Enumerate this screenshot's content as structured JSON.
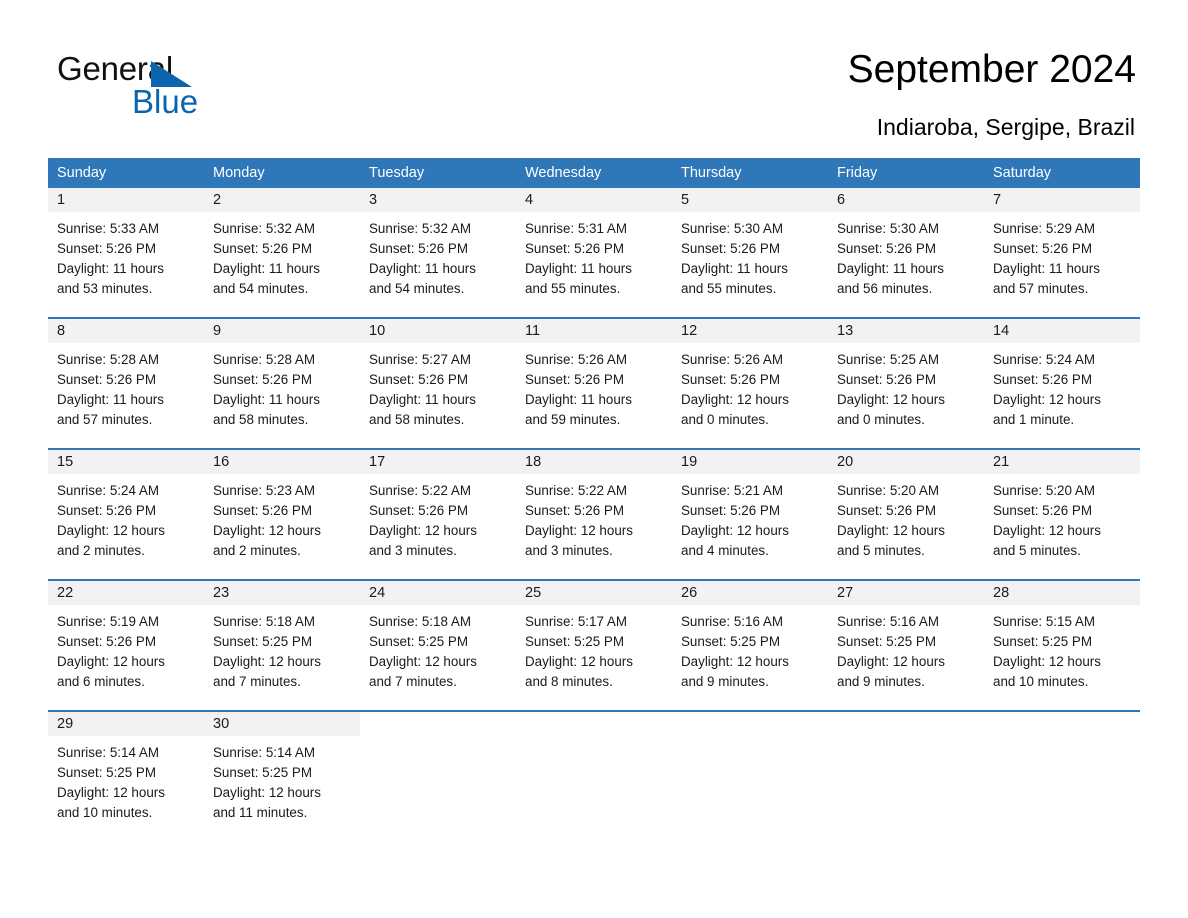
{
  "logo": {
    "word1": "General",
    "word2": "Blue",
    "triangle_color": "#0d66ad",
    "text_color": "#111111"
  },
  "header": {
    "title": "September 2024",
    "subtitle": "Indiaroba, Sergipe, Brazil"
  },
  "theme": {
    "header_bg": "#2e77b8",
    "header_text": "#ffffff",
    "daynum_bg": "#f2f2f2",
    "cell_bg": "#ffffff",
    "row_divider": "#2e77b8",
    "body_text": "#1a1a1a"
  },
  "weekdays": [
    "Sunday",
    "Monday",
    "Tuesday",
    "Wednesday",
    "Thursday",
    "Friday",
    "Saturday"
  ],
  "labels": {
    "sunrise_prefix": "Sunrise:",
    "sunset_prefix": "Sunset:",
    "daylight_prefix": "Daylight:"
  },
  "weeks": [
    {
      "days": [
        {
          "num": "1",
          "sunrise": "Sunrise: 5:33 AM",
          "sunset": "Sunset: 5:26 PM",
          "daylight1": "Daylight: 11 hours",
          "daylight2": "and 53 minutes."
        },
        {
          "num": "2",
          "sunrise": "Sunrise: 5:32 AM",
          "sunset": "Sunset: 5:26 PM",
          "daylight1": "Daylight: 11 hours",
          "daylight2": "and 54 minutes."
        },
        {
          "num": "3",
          "sunrise": "Sunrise: 5:32 AM",
          "sunset": "Sunset: 5:26 PM",
          "daylight1": "Daylight: 11 hours",
          "daylight2": "and 54 minutes."
        },
        {
          "num": "4",
          "sunrise": "Sunrise: 5:31 AM",
          "sunset": "Sunset: 5:26 PM",
          "daylight1": "Daylight: 11 hours",
          "daylight2": "and 55 minutes."
        },
        {
          "num": "5",
          "sunrise": "Sunrise: 5:30 AM",
          "sunset": "Sunset: 5:26 PM",
          "daylight1": "Daylight: 11 hours",
          "daylight2": "and 55 minutes."
        },
        {
          "num": "6",
          "sunrise": "Sunrise: 5:30 AM",
          "sunset": "Sunset: 5:26 PM",
          "daylight1": "Daylight: 11 hours",
          "daylight2": "and 56 minutes."
        },
        {
          "num": "7",
          "sunrise": "Sunrise: 5:29 AM",
          "sunset": "Sunset: 5:26 PM",
          "daylight1": "Daylight: 11 hours",
          "daylight2": "and 57 minutes."
        }
      ]
    },
    {
      "days": [
        {
          "num": "8",
          "sunrise": "Sunrise: 5:28 AM",
          "sunset": "Sunset: 5:26 PM",
          "daylight1": "Daylight: 11 hours",
          "daylight2": "and 57 minutes."
        },
        {
          "num": "9",
          "sunrise": "Sunrise: 5:28 AM",
          "sunset": "Sunset: 5:26 PM",
          "daylight1": "Daylight: 11 hours",
          "daylight2": "and 58 minutes."
        },
        {
          "num": "10",
          "sunrise": "Sunrise: 5:27 AM",
          "sunset": "Sunset: 5:26 PM",
          "daylight1": "Daylight: 11 hours",
          "daylight2": "and 58 minutes."
        },
        {
          "num": "11",
          "sunrise": "Sunrise: 5:26 AM",
          "sunset": "Sunset: 5:26 PM",
          "daylight1": "Daylight: 11 hours",
          "daylight2": "and 59 minutes."
        },
        {
          "num": "12",
          "sunrise": "Sunrise: 5:26 AM",
          "sunset": "Sunset: 5:26 PM",
          "daylight1": "Daylight: 12 hours",
          "daylight2": "and 0 minutes."
        },
        {
          "num": "13",
          "sunrise": "Sunrise: 5:25 AM",
          "sunset": "Sunset: 5:26 PM",
          "daylight1": "Daylight: 12 hours",
          "daylight2": "and 0 minutes."
        },
        {
          "num": "14",
          "sunrise": "Sunrise: 5:24 AM",
          "sunset": "Sunset: 5:26 PM",
          "daylight1": "Daylight: 12 hours",
          "daylight2": "and 1 minute."
        }
      ]
    },
    {
      "days": [
        {
          "num": "15",
          "sunrise": "Sunrise: 5:24 AM",
          "sunset": "Sunset: 5:26 PM",
          "daylight1": "Daylight: 12 hours",
          "daylight2": "and 2 minutes."
        },
        {
          "num": "16",
          "sunrise": "Sunrise: 5:23 AM",
          "sunset": "Sunset: 5:26 PM",
          "daylight1": "Daylight: 12 hours",
          "daylight2": "and 2 minutes."
        },
        {
          "num": "17",
          "sunrise": "Sunrise: 5:22 AM",
          "sunset": "Sunset: 5:26 PM",
          "daylight1": "Daylight: 12 hours",
          "daylight2": "and 3 minutes."
        },
        {
          "num": "18",
          "sunrise": "Sunrise: 5:22 AM",
          "sunset": "Sunset: 5:26 PM",
          "daylight1": "Daylight: 12 hours",
          "daylight2": "and 3 minutes."
        },
        {
          "num": "19",
          "sunrise": "Sunrise: 5:21 AM",
          "sunset": "Sunset: 5:26 PM",
          "daylight1": "Daylight: 12 hours",
          "daylight2": "and 4 minutes."
        },
        {
          "num": "20",
          "sunrise": "Sunrise: 5:20 AM",
          "sunset": "Sunset: 5:26 PM",
          "daylight1": "Daylight: 12 hours",
          "daylight2": "and 5 minutes."
        },
        {
          "num": "21",
          "sunrise": "Sunrise: 5:20 AM",
          "sunset": "Sunset: 5:26 PM",
          "daylight1": "Daylight: 12 hours",
          "daylight2": "and 5 minutes."
        }
      ]
    },
    {
      "days": [
        {
          "num": "22",
          "sunrise": "Sunrise: 5:19 AM",
          "sunset": "Sunset: 5:26 PM",
          "daylight1": "Daylight: 12 hours",
          "daylight2": "and 6 minutes."
        },
        {
          "num": "23",
          "sunrise": "Sunrise: 5:18 AM",
          "sunset": "Sunset: 5:25 PM",
          "daylight1": "Daylight: 12 hours",
          "daylight2": "and 7 minutes."
        },
        {
          "num": "24",
          "sunrise": "Sunrise: 5:18 AM",
          "sunset": "Sunset: 5:25 PM",
          "daylight1": "Daylight: 12 hours",
          "daylight2": "and 7 minutes."
        },
        {
          "num": "25",
          "sunrise": "Sunrise: 5:17 AM",
          "sunset": "Sunset: 5:25 PM",
          "daylight1": "Daylight: 12 hours",
          "daylight2": "and 8 minutes."
        },
        {
          "num": "26",
          "sunrise": "Sunrise: 5:16 AM",
          "sunset": "Sunset: 5:25 PM",
          "daylight1": "Daylight: 12 hours",
          "daylight2": "and 9 minutes."
        },
        {
          "num": "27",
          "sunrise": "Sunrise: 5:16 AM",
          "sunset": "Sunset: 5:25 PM",
          "daylight1": "Daylight: 12 hours",
          "daylight2": "and 9 minutes."
        },
        {
          "num": "28",
          "sunrise": "Sunrise: 5:15 AM",
          "sunset": "Sunset: 5:25 PM",
          "daylight1": "Daylight: 12 hours",
          "daylight2": "and 10 minutes."
        }
      ]
    },
    {
      "days": [
        {
          "num": "29",
          "sunrise": "Sunrise: 5:14 AM",
          "sunset": "Sunset: 5:25 PM",
          "daylight1": "Daylight: 12 hours",
          "daylight2": "and 10 minutes."
        },
        {
          "num": "30",
          "sunrise": "Sunrise: 5:14 AM",
          "sunset": "Sunset: 5:25 PM",
          "daylight1": "Daylight: 12 hours",
          "daylight2": "and 11 minutes."
        },
        {
          "num": "",
          "sunrise": "",
          "sunset": "",
          "daylight1": "",
          "daylight2": ""
        },
        {
          "num": "",
          "sunrise": "",
          "sunset": "",
          "daylight1": "",
          "daylight2": ""
        },
        {
          "num": "",
          "sunrise": "",
          "sunset": "",
          "daylight1": "",
          "daylight2": ""
        },
        {
          "num": "",
          "sunrise": "",
          "sunset": "",
          "daylight1": "",
          "daylight2": ""
        },
        {
          "num": "",
          "sunrise": "",
          "sunset": "",
          "daylight1": "",
          "daylight2": ""
        }
      ]
    }
  ]
}
